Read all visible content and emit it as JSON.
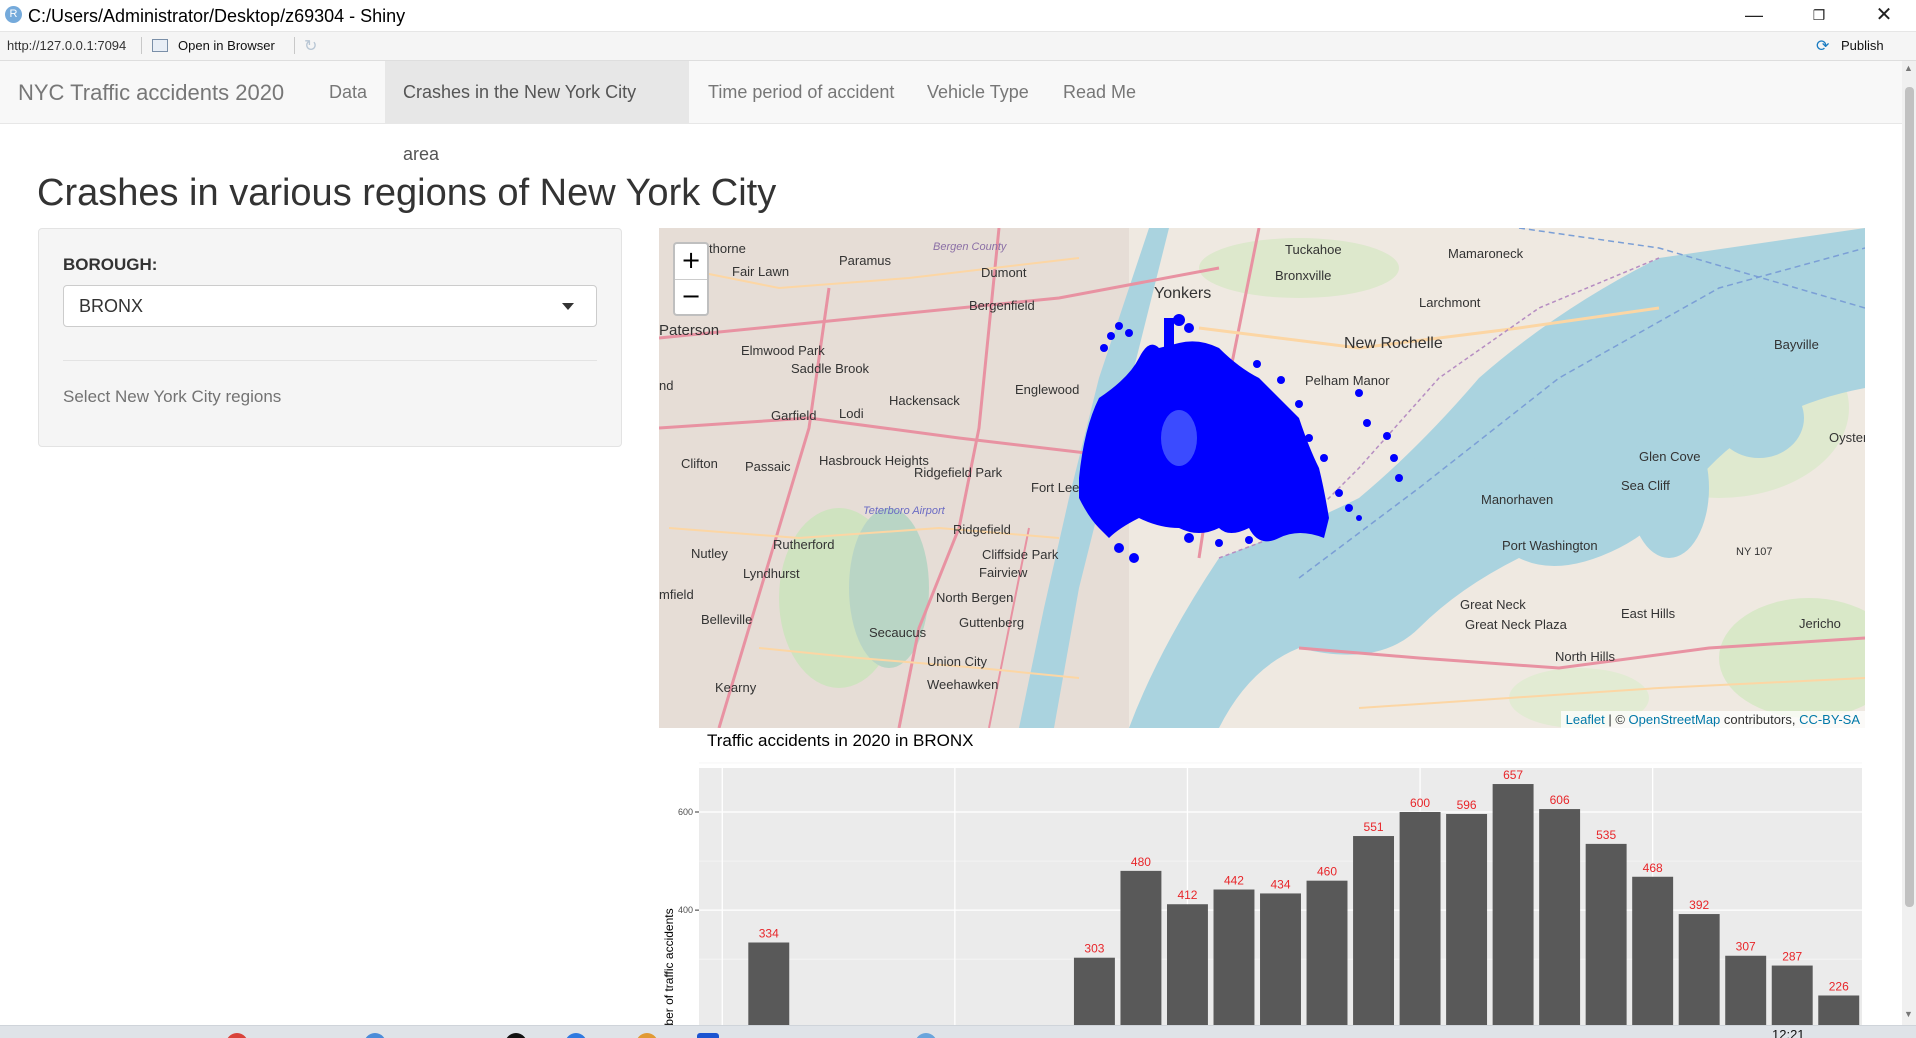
{
  "window": {
    "title": "C:/Users/Administrator/Desktop/z69304 - Shiny",
    "app_icon": "R",
    "minimize": "—",
    "maximize": "❐",
    "close": "✕"
  },
  "toolbar": {
    "url": "http://127.0.0.1:7094",
    "open_in_browser": "Open in Browser",
    "publish": "Publish"
  },
  "navbar": {
    "brand": "NYC Traffic accidents 2020",
    "tabs": [
      {
        "label": "Data",
        "active": false
      },
      {
        "label": "Crashes in the New York City area",
        "active": true
      },
      {
        "label": "Time period of accident",
        "active": false
      },
      {
        "label": "Vehicle Type",
        "active": false
      },
      {
        "label": "Read Me",
        "active": false
      }
    ]
  },
  "page": {
    "title": "Crashes in various regions of New York City"
  },
  "sidebar": {
    "borough_label": "BOROUGH:",
    "borough_value": "BRONX",
    "help_text": "Select New York City regions"
  },
  "map": {
    "zoom_in": "+",
    "zoom_out": "−",
    "attribution_leaflet": "Leaflet",
    "attribution_sep": " | © ",
    "attribution_osm": "OpenStreetMap",
    "attribution_mid": " contributors, ",
    "attribution_license": "CC-BY-SA",
    "point_color": "#0000ff",
    "place_labels": [
      "thorne",
      "Paramus",
      "Bergen County",
      "Dumont",
      "Fair Lawn",
      "Tuckahoe",
      "Mamaroneck",
      "Bronxville",
      "Yonkers",
      "Bergenfield",
      "Larchmont",
      "Paterson",
      "New Rochelle",
      "Elmwood Park",
      "Bayville",
      "Saddle Brook",
      "Pelham Manor",
      "Englewood",
      "Hackensack",
      "Garfield",
      "Lodi",
      "Oyster",
      "Glen Cove",
      "Clifton",
      "Passaic",
      "Hasbrouck Heights",
      "Ridgefield Park",
      "Fort Lee",
      "Sea Cliff",
      "Manorhaven",
      "Teterboro Airport",
      "Ridgefield",
      "Rutherford",
      "Port Washington",
      "NY 107",
      "Nutley",
      "Cliffside Park",
      "Lyndhurst",
      "Fairview",
      "North Bergen",
      "Great Neck",
      "East Hills",
      "Belleville",
      "Great Neck Plaza",
      "Secaucus",
      "Guttenberg",
      "Jericho",
      "North Hills",
      "Union City",
      "Weehawken",
      "Kearny",
      "mfield",
      "nd"
    ]
  },
  "chart_data": {
    "type": "bar",
    "title": "Traffic accidents in 2020 in BRONX",
    "xlabel": "",
    "ylabel": "Number of traffic accidents",
    "ylabel_visible": "ber of traffic accidents",
    "yticks": [
      400,
      600
    ],
    "ylim_visible": [
      285,
      705
    ],
    "bar_color": "#595959",
    "label_color": "#e8262a",
    "panel_color": "#ebebeb",
    "grid": true,
    "values": [
      null,
      334,
      null,
      null,
      null,
      null,
      null,
      null,
      303,
      480,
      412,
      442,
      434,
      460,
      551,
      600,
      596,
      657,
      606,
      535,
      468,
      392,
      307,
      287,
      226
    ],
    "labels": [
      "",
      "334",
      "",
      "",
      "",
      "",
      "",
      "",
      "303",
      "480",
      "412",
      "442",
      "434",
      "460",
      "551",
      "600",
      "596",
      "657",
      "606",
      "535",
      "468",
      "392",
      "307",
      "287",
      "226"
    ]
  },
  "taskbar": {
    "clock": "12:21"
  }
}
